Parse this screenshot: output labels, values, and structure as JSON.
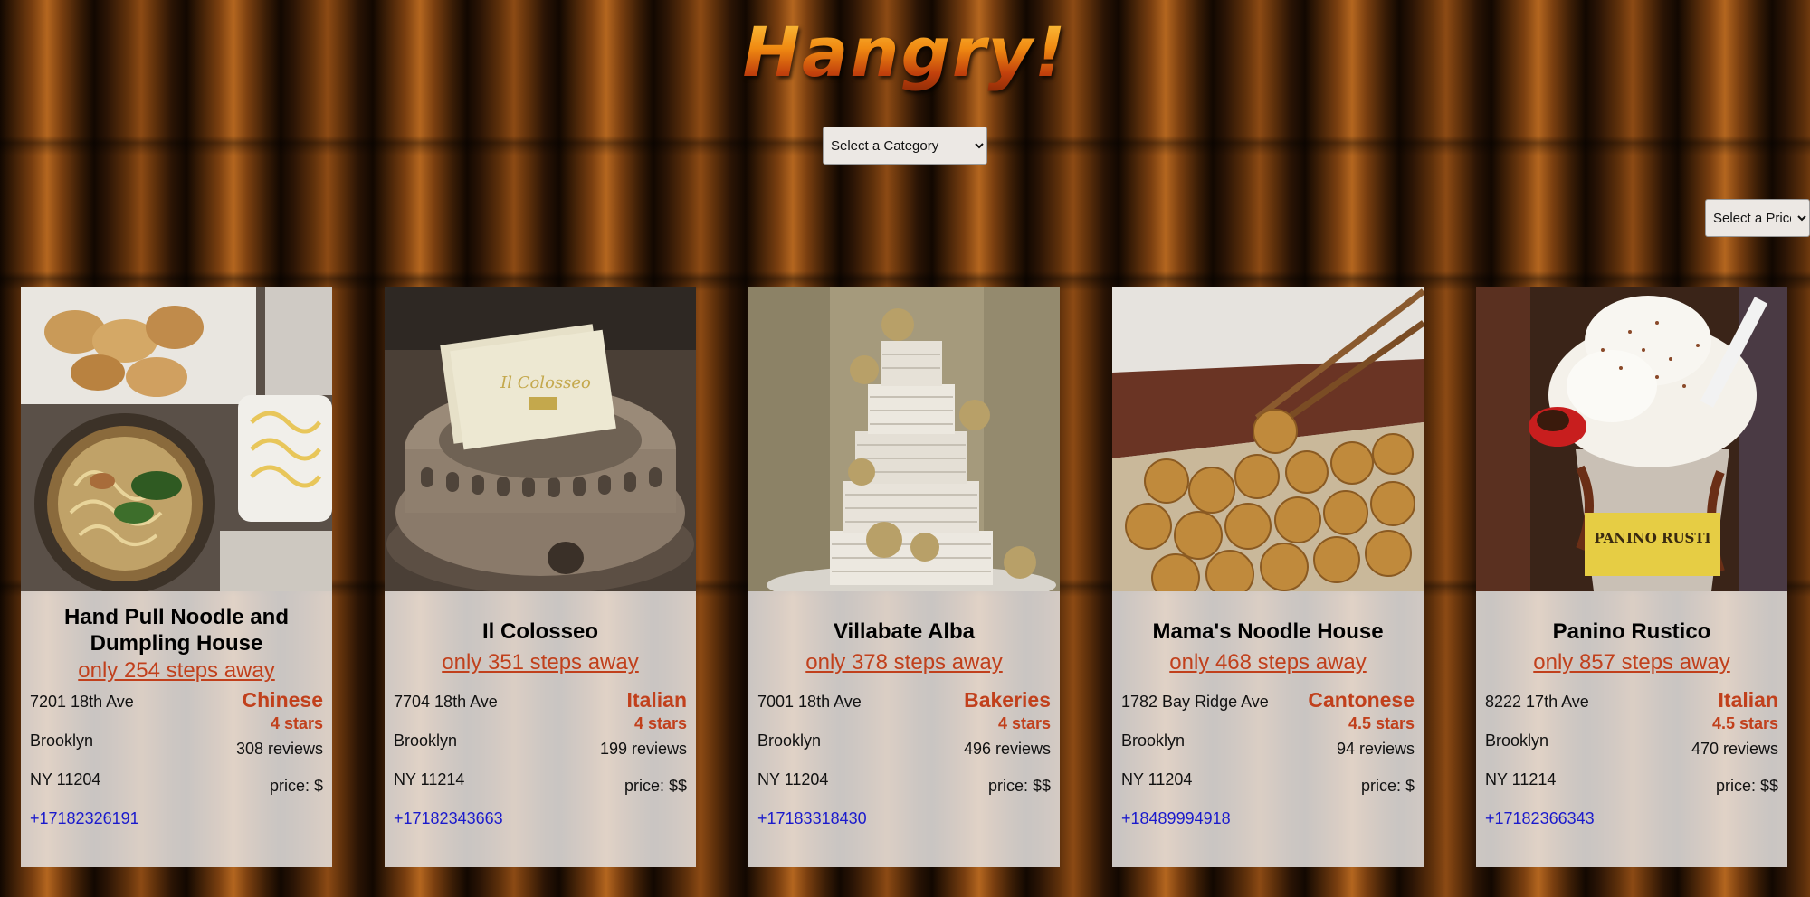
{
  "app": {
    "title": "Hangry!"
  },
  "filters": {
    "category": {
      "selected": "Select a Category",
      "options": [
        "Select a Category"
      ]
    },
    "price": {
      "selected": "Select a Price",
      "options": [
        "Select a Price"
      ]
    }
  },
  "colors": {
    "accent": "#c1401c",
    "link": "#1a1acc",
    "card_bg": "#e8e4e2"
  },
  "restaurants": [
    {
      "name": "Hand Pull Noodle and Dumpling House",
      "steps": "only 254 steps away",
      "address_line1": "7201 18th Ave",
      "address_line2": "Brooklyn",
      "address_line3": "NY 11204",
      "phone": "+17182326191",
      "category": "Chinese",
      "stars": "4 stars",
      "reviews": "308 reviews",
      "price": "price: $",
      "photo": "noodle-soup-dumplings-photo"
    },
    {
      "name": "Il Colosseo",
      "steps": "only 351 steps away",
      "address_line1": "7704 18th Ave",
      "address_line2": "Brooklyn",
      "address_line3": "NY 11214",
      "phone": "+17182343663",
      "category": "Italian",
      "stars": "4 stars",
      "reviews": "199 reviews",
      "price": "price: $$",
      "photo": "colosseum-card-holder-photo"
    },
    {
      "name": "Villabate Alba",
      "steps": "only 378 steps away",
      "address_line1": "7001 18th Ave",
      "address_line2": "Brooklyn",
      "address_line3": "NY 11204",
      "phone": "+17183318430",
      "category": "Bakeries",
      "stars": "4 stars",
      "reviews": "496 reviews",
      "price": "price: $$",
      "photo": "wedding-cake-photo"
    },
    {
      "name": "Mama's Noodle House",
      "steps": "only 468 steps away",
      "address_line1": "1782 Bay Ridge Ave",
      "address_line2": "Brooklyn",
      "address_line3": "NY 11204",
      "phone": "+18489994918",
      "category": "Cantonese",
      "stars": "4.5 stars",
      "reviews": "94 reviews",
      "price": "price: $",
      "photo": "fried-balls-chopsticks-photo"
    },
    {
      "name": "Panino Rustico",
      "steps": "only 857 steps away",
      "address_line1": "8222 17th Ave",
      "address_line2": "Brooklyn",
      "address_line3": "NY 11214",
      "phone": "+17182366343",
      "category": "Italian",
      "stars": "4.5 stars",
      "reviews": "470 reviews",
      "price": "price: $$",
      "photo": "whipped-cream-dessert-cup-photo",
      "photo_text": "PANINO RUSTI"
    }
  ]
}
